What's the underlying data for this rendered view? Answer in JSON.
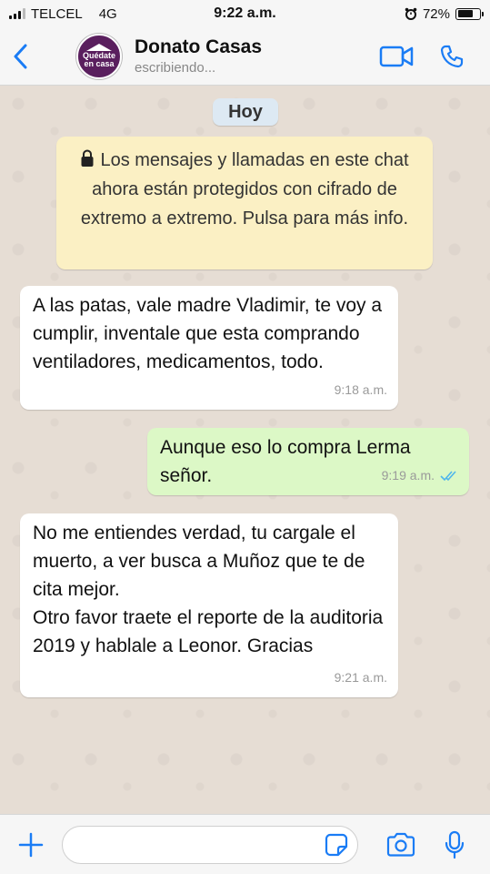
{
  "status_bar": {
    "carrier": "TELCEL",
    "network": "4G",
    "time": "9:22 a.m.",
    "battery_percent": "72%",
    "battery_level": 0.72
  },
  "header": {
    "contact_name": "Donato Casas",
    "contact_status": "escribiendo...",
    "avatar_text": "Quédate en casa",
    "accent_color": "#1a7cf5"
  },
  "chat": {
    "date_label": "Hoy",
    "encryption_notice": "Los mensajes y llamadas en este chat ahora están protegidos con cifrado de extremo a extremo. Pulsa para más info.",
    "messages": [
      {
        "direction": "incoming",
        "text": "A las patas, vale madre Vladimir, te voy a cumplir, inventale que esta comprando ventiladores, medicamentos, todo.",
        "time": "9:18 a.m."
      },
      {
        "direction": "outgoing",
        "text": "Aunque eso lo compra Lerma señor.",
        "time": "9:19 a.m.",
        "read": true
      },
      {
        "direction": "incoming",
        "text": "No me entiendes verdad, tu cargale el muerto, a ver busca a Muñoz que te de cita mejor.\nOtro favor traete el reporte de la auditoria 2019 y hablale a Leonor. Gracias",
        "time": "9:21 a.m."
      }
    ]
  },
  "input_bar": {
    "placeholder": ""
  },
  "icons": {
    "back": "chevron-left-icon",
    "video": "video-camera-icon",
    "call": "phone-icon",
    "add": "plus-icon",
    "sticker": "sticker-icon",
    "camera": "camera-icon",
    "mic": "microphone-icon",
    "lock": "lock-icon",
    "alarm": "alarm-icon",
    "read_receipt": "double-check-icon"
  }
}
